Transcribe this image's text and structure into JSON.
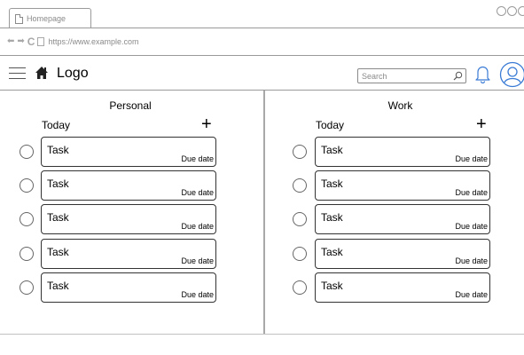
{
  "browser": {
    "tab_title": "Homepage",
    "url": "https://www.example.com"
  },
  "header": {
    "logo": "Logo",
    "search_placeholder": "Search"
  },
  "columns": [
    {
      "title": "Personal",
      "today_label": "Today",
      "add_symbol": "+",
      "tasks": [
        {
          "name": "Task",
          "due": "Due date"
        },
        {
          "name": "Task",
          "due": "Due date"
        },
        {
          "name": "Task",
          "due": "Due date"
        },
        {
          "name": "Task",
          "due": "Due date"
        },
        {
          "name": "Task",
          "due": "Due date"
        }
      ]
    },
    {
      "title": "Work",
      "today_label": "Today",
      "add_symbol": "+",
      "tasks": [
        {
          "name": "Task",
          "due": "Due date"
        },
        {
          "name": "Task",
          "due": "Due date"
        },
        {
          "name": "Task",
          "due": "Due date"
        },
        {
          "name": "Task",
          "due": "Due date"
        },
        {
          "name": "Task",
          "due": "Due date"
        }
      ]
    }
  ],
  "icons": {
    "browser": [
      "document-icon",
      "back-arrow-icon",
      "forward-arrow-icon",
      "reload-icon",
      "window-control-icon"
    ],
    "header": [
      "hamburger-menu-icon",
      "home-icon",
      "search-icon",
      "bell-icon",
      "user-avatar-icon"
    ]
  },
  "colors": {
    "line": "#9a9a9a",
    "muted_text": "#8a8a8a",
    "text": "#000000",
    "card_border": "#333333"
  }
}
